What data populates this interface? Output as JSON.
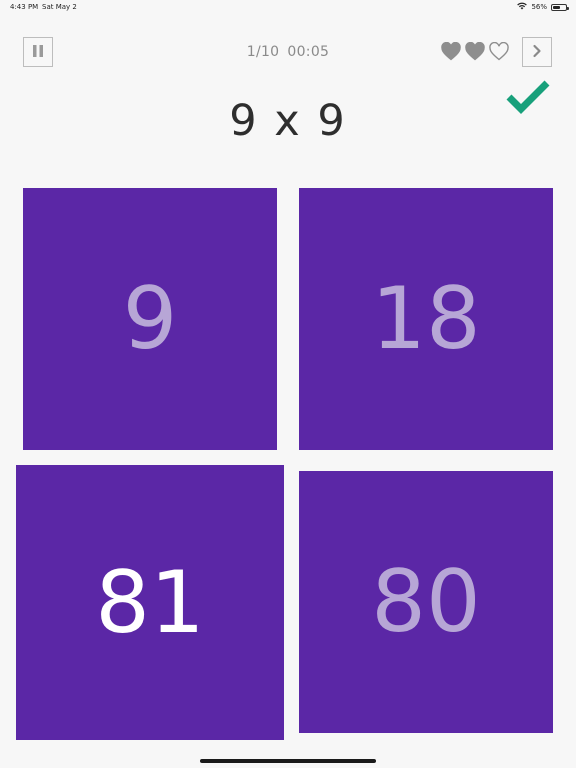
{
  "status_bar": {
    "time": "4:43 PM",
    "date": "Sat May 2",
    "battery": "56%",
    "battery_level": 0.56,
    "wifi_icon": "wifi-icon",
    "battery_icon": "battery-icon"
  },
  "toolbar": {
    "pause_icon": "pause-icon",
    "next_icon": "chevron-right-icon",
    "progress": "1/10",
    "timer": "00:05",
    "lives_filled": 2,
    "lives_total": 3
  },
  "feedback": {
    "icon": "checkmark-icon",
    "color": "#18a07b"
  },
  "question": "9 x 9",
  "answers": [
    {
      "label": "9",
      "selected": false
    },
    {
      "label": "18",
      "selected": false
    },
    {
      "label": "81",
      "selected": true
    },
    {
      "label": "80",
      "selected": false
    }
  ],
  "colors": {
    "tile": "#5b27a6",
    "tile_text": "#b7a6d6",
    "tile_text_selected": "#ffffff",
    "heart": "#8e8e8e",
    "background": "#f7f7f7"
  }
}
